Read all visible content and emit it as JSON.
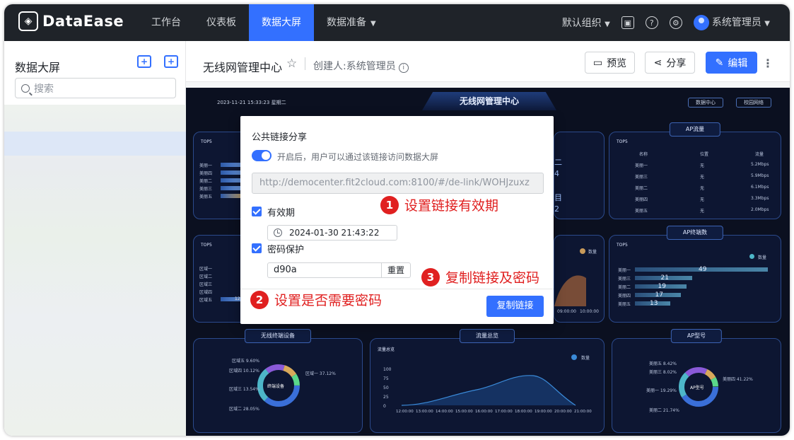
{
  "topbar": {
    "logo_text": "DataEase",
    "nav": [
      "工作台",
      "仪表板",
      "数据大屏",
      "数据准备"
    ],
    "active_nav": "数据大屏",
    "org": "默认组织",
    "user": "系统管理员"
  },
  "sidebar": {
    "title": "数据大屏",
    "search_placeholder": "搜索"
  },
  "header": {
    "title": "无线网管理中心",
    "creator": "创建人:系统管理员",
    "preview_label": "预览",
    "share_label": "分享",
    "edit_label": "编辑"
  },
  "screen": {
    "datetime": "2023-11-21  15:33:23  星期二",
    "title": "无线网管理中心",
    "btn_data_center": "数据中心",
    "btn_campus": "校园网络",
    "ap_traffic": "AP流量",
    "ap_terminals": "AP终端数",
    "wireless_devices": "无线终端设备",
    "traffic_overview": "流量总览",
    "ap_model": "AP型号",
    "top5": "TOP5",
    "table_headers": [
      "名称",
      "位置",
      "流量"
    ],
    "table_rows": [
      [
        "美丽一",
        "无",
        "5.2Mbps"
      ],
      [
        "美丽三",
        "无",
        "5.9Mbps"
      ],
      [
        "美丽二",
        "无",
        "6.1Mbps"
      ],
      [
        "美丽四",
        "无",
        "3.3Mbps"
      ],
      [
        "美丽五",
        "无",
        "2.0Mbps"
      ]
    ],
    "terminal_labels": [
      "美丽一",
      "美丽三",
      "美丽二",
      "美丽四",
      "美丽五"
    ],
    "terminal_values": [
      "49",
      "21",
      "19",
      "17",
      "13"
    ],
    "terminal_legend": "数量",
    "center_donut": "终端设备",
    "ap_donut": "AP型号",
    "left_top_labels": [
      "美丽一",
      "美丽四",
      "美丽二",
      "美丽三",
      "美丽五"
    ],
    "left_mid_labels": [
      "区域一",
      "区域二",
      "区域三",
      "区域四",
      "区域五"
    ],
    "left_mid_value": "12",
    "traffic_label": "流量总览",
    "traffic_legend": "数量",
    "y_ticks": [
      "100",
      "75",
      "50",
      "25",
      "0"
    ],
    "x_ticks": [
      "12:00:00",
      "13:00:00",
      "14:00:00",
      "15:00:00",
      "16:00:00",
      "17:00:00",
      "18:00:00",
      "19:00:00",
      "20:00:00",
      "21:00:00"
    ],
    "mid_x_ticks": [
      "09:00:00",
      "10:00:00"
    ],
    "mid_legend": "数量",
    "donut_labels": [
      "区域五 9.60%",
      "区域四 10.12%",
      "区域三 13.54%",
      "区域二 28.05%",
      "区域一 37.12%"
    ],
    "ap_donut_labels": [
      "美丽五 8.42%",
      "美丽三 8.02%",
      "美丽一 19.29%",
      "美丽二 21.74%",
      "美丽四 41.22%"
    ],
    "stat_chars": [
      "二",
      "4",
      "目",
      "2"
    ]
  },
  "modal": {
    "title": "公共链接分享",
    "toggle_label": "开启后，用户可以通过该链接访问数据大屏",
    "link": "http://democenter.fit2cloud.com:8100/#/de-link/WOHJzuxz",
    "validity_label": "有效期",
    "validity_value": "2024-01-30 21:43:22",
    "password_label": "密码保护",
    "password_value": "d90a",
    "reset_label": "重置",
    "copy_label": "复制链接"
  },
  "annotations": [
    {
      "num": "1",
      "text": "设置链接有效期"
    },
    {
      "num": "2",
      "text": "设置是否需要密码"
    },
    {
      "num": "3",
      "text": "复制链接及密码"
    }
  ]
}
